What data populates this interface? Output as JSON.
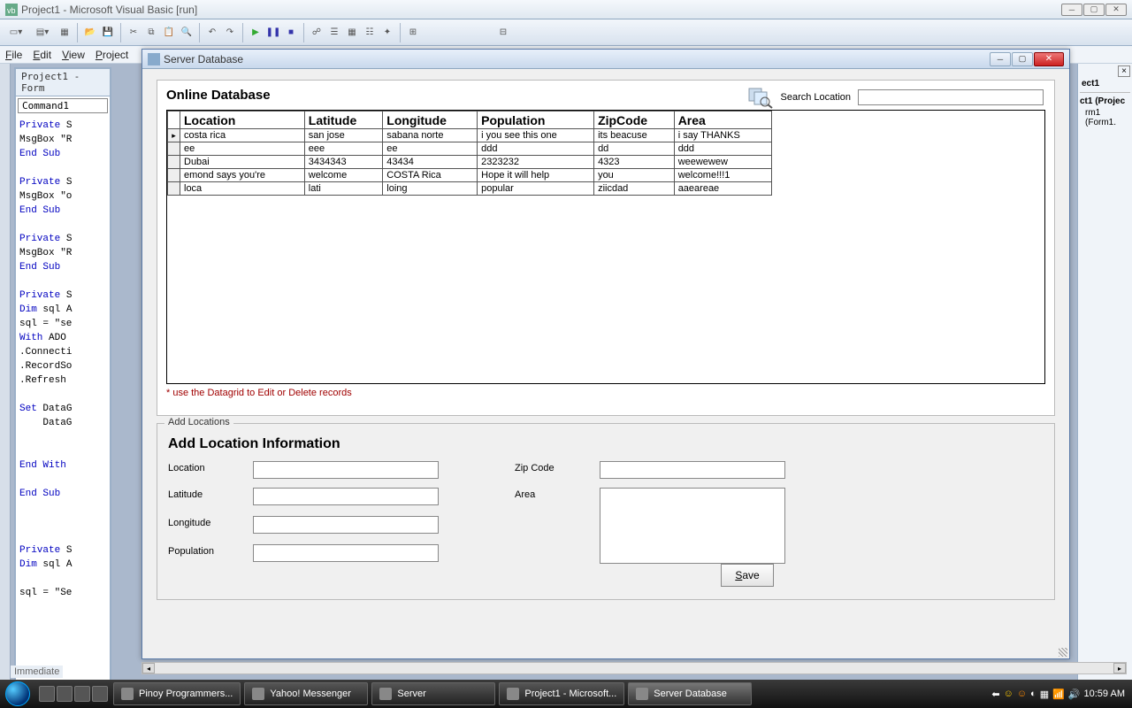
{
  "vb": {
    "title": "Project1 - Microsoft Visual Basic [run]",
    "menu": [
      "File",
      "Edit",
      "View",
      "Project"
    ],
    "project_tab": "Project1 - Form",
    "combo": "Command1",
    "code_lines": [
      "Private S",
      "MsgBox \"R",
      "End Sub",
      "",
      "Private S",
      "MsgBox \"o",
      "End Sub",
      "",
      "Private S",
      "MsgBox \"R",
      "End Sub",
      "",
      "Private S",
      "Dim sql A",
      "sql = \"se",
      "With ADO ",
      ".Connecti",
      ".RecordSo",
      ".Refresh ",
      "",
      "Set DataG",
      "    DataG",
      "",
      "",
      "End With ",
      "",
      "End Sub",
      "",
      "",
      "",
      "Private S",
      "Dim sql A",
      "",
      "sql = \"Se"
    ],
    "right_panel_title": "ect1",
    "right_tree1": "ct1 (Projec",
    "right_tree2": "rm1 (Form1."
  },
  "dialog": {
    "title": "Server Database",
    "panel_title": "Online Database",
    "search_label": "Search Location",
    "search_value": "",
    "columns": [
      "Location",
      "Latitude",
      "Longitude",
      "Population",
      "ZipCode",
      "Area"
    ],
    "rows": [
      [
        "costa rica",
        "san jose",
        "sabana norte",
        "i you see this one",
        "its beacuse",
        "i say THANKS"
      ],
      [
        "ee",
        "eee",
        "ee",
        "ddd",
        "dd",
        "ddd"
      ],
      [
        "Dubai",
        "3434343",
        "43434",
        "2323232",
        "4323",
        "weewewew"
      ],
      [
        "emond says you're",
        "welcome",
        "COSTA Rica",
        "Hope it will help",
        "you",
        "welcome!!!1"
      ],
      [
        "loca",
        "lati",
        "loing",
        "popular",
        "ziicdad",
        "aaeareae"
      ]
    ],
    "hint": "* use the Datagrid to Edit or Delete records",
    "fieldset_legend": "Add Locations",
    "fieldset_title": "Add Location Information",
    "labels": {
      "location": "Location",
      "latitude": "Latitude",
      "longitude": "Longitude",
      "population": "Population",
      "zipcode": "Zip Code",
      "area": "Area"
    },
    "save": "Save"
  },
  "immediate": "Immediate",
  "taskbar": {
    "items": [
      {
        "label": "Pinoy Programmers...",
        "active": false
      },
      {
        "label": "Yahoo! Messenger",
        "active": false
      },
      {
        "label": "Server",
        "active": false
      },
      {
        "label": "Project1 - Microsoft...",
        "active": false
      },
      {
        "label": "Server Database",
        "active": true
      }
    ],
    "clock": "10:59 AM"
  }
}
